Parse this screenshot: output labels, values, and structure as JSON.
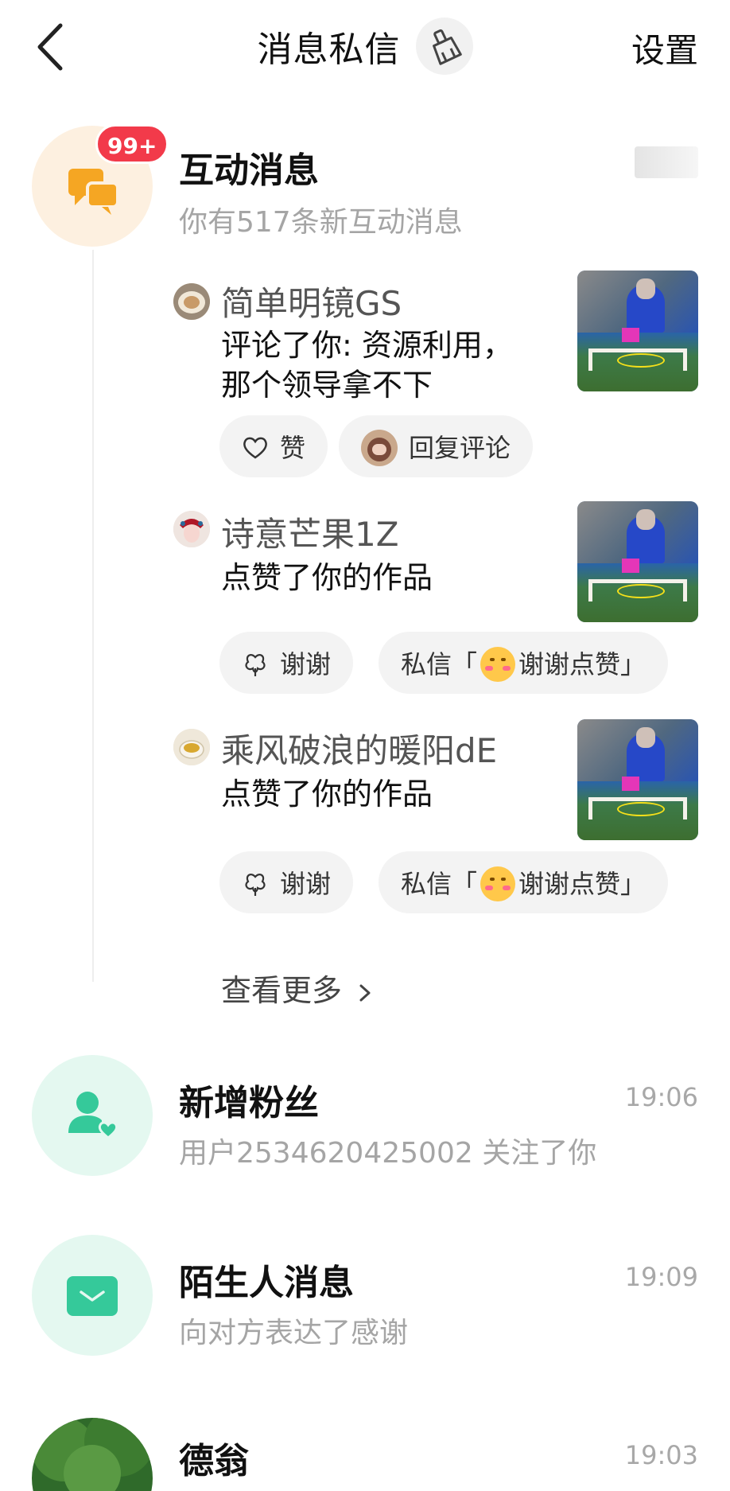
{
  "header": {
    "title": "消息私信",
    "settings_label": "设置"
  },
  "interactions": {
    "title": "互动消息",
    "badge": "99+",
    "subtitle": "你有517条新互动消息",
    "items": [
      {
        "user": "简单明镜GS",
        "text_line1": "评论了你: 资源利用，",
        "text_line2": "那个领导拿不下",
        "action1": "赞",
        "action2": "回复评论"
      },
      {
        "user": "诗意芒果1Z",
        "text_line1": "点赞了你的作品",
        "action1": "谢谢",
        "action2_prefix": "私信「",
        "action2_text": "谢谢点赞",
        "action2_suffix": "」"
      },
      {
        "user": "乘风破浪的暖阳dE",
        "text_line1": "点赞了你的作品",
        "action1": "谢谢",
        "action2_prefix": "私信「",
        "action2_text": "谢谢点赞",
        "action2_suffix": "」"
      }
    ],
    "more_label": "查看更多"
  },
  "list": [
    {
      "title": "新增粉丝",
      "subtitle": "用户2534620425002 关注了你",
      "time": "19:06",
      "icon": "add-fan-icon"
    },
    {
      "title": "陌生人消息",
      "subtitle": "向对方表达了感谢",
      "time": "19:09",
      "icon": "mail-icon"
    },
    {
      "title": "德翁",
      "subtitle": "",
      "time": "19:03",
      "icon": "avatar-forest"
    }
  ],
  "colors": {
    "badge": "#f23a4a",
    "accent_green": "#35c99a",
    "accent_orange": "#f5a623"
  }
}
